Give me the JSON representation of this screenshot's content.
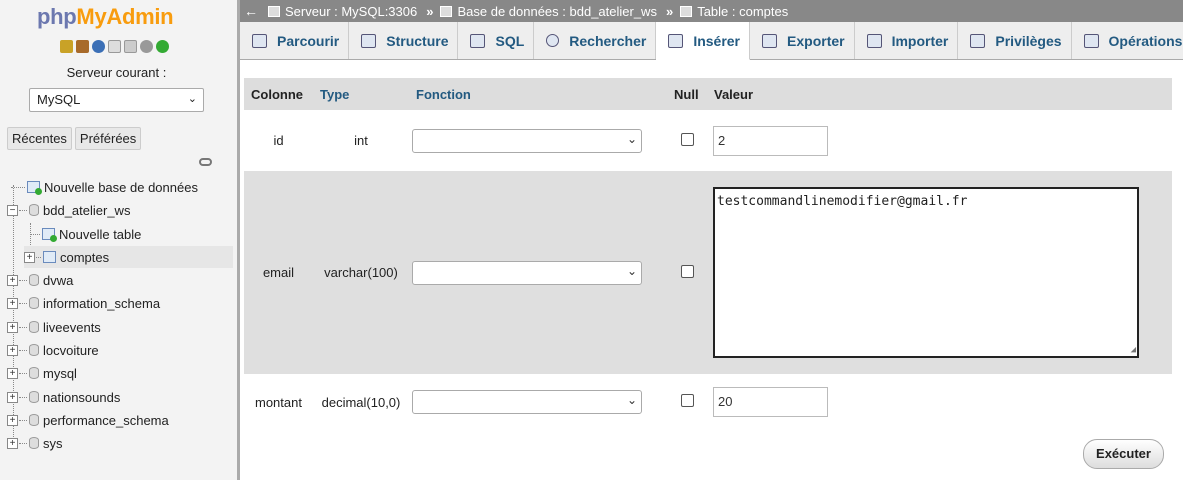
{
  "sidebar": {
    "logo_a": "php",
    "logo_b": "MyAdmin",
    "server_label": "Serveur courant :",
    "server_value": "MySQL",
    "tab_recent": "Récentes",
    "tab_favorites": "Préférées",
    "tree": {
      "new_db": "Nouvelle base de données",
      "bdd_atelier_ws": "bdd_atelier_ws",
      "new_table": "Nouvelle table",
      "comptes": "comptes",
      "databases": [
        "dvwa",
        "information_schema",
        "liveevents",
        "locvoiture",
        "mysql",
        "nationsounds",
        "performance_schema",
        "sys"
      ]
    }
  },
  "breadcrumb": {
    "server": "Serveur : MySQL:3306",
    "database": "Base de données : bdd_atelier_ws",
    "table": "Table : comptes",
    "sep": "»"
  },
  "tabs": [
    "Parcourir",
    "Structure",
    "SQL",
    "Rechercher",
    "Insérer",
    "Exporter",
    "Importer",
    "Privilèges",
    "Opérations"
  ],
  "active_tab": "Insérer",
  "form": {
    "headers": {
      "column": "Colonne",
      "type": "Type",
      "function": "Fonction",
      "null": "Null",
      "value": "Valeur"
    },
    "rows": [
      {
        "column": "id",
        "type": "int",
        "value": "2"
      },
      {
        "column": "email",
        "type": "varchar(100)",
        "value": "testcommandlinemodifier@gmail.fr"
      },
      {
        "column": "montant",
        "type": "decimal(10,0)",
        "value": "20"
      }
    ],
    "execute": "Exécuter"
  }
}
